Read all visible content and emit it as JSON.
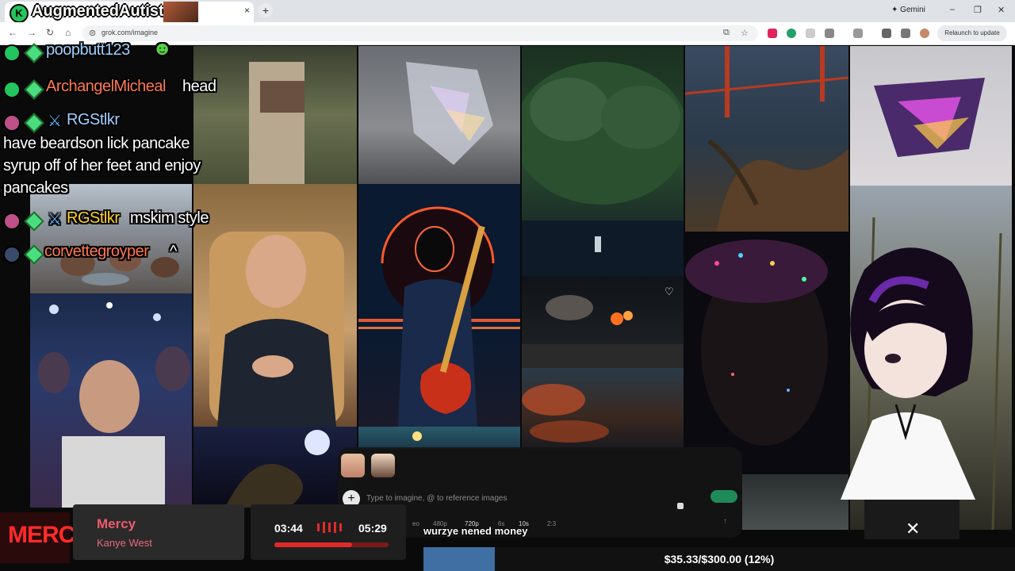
{
  "browser": {
    "tab_title": "AugmentedAutist",
    "tab_favicon_letter": "K",
    "url": "grok.com/imagine",
    "gemini_label": "Gemini",
    "relaunch_label": "Relaunch to update",
    "win_min": "–",
    "win_max": "❐",
    "win_close": "✕",
    "tab_close": "×",
    "new_tab": "+"
  },
  "chat": {
    "messages": [
      {
        "user": "poopbutt123",
        "text": "",
        "user_color": "#9ed0ff"
      },
      {
        "user": "ArchangelMicheal",
        "text": "head",
        "user_color": "#ff7a50"
      },
      {
        "user": "RGStlkr",
        "text": "",
        "user_color": "#9ed0ff"
      },
      {
        "user": "",
        "text": "have beardson lick pancake",
        "user_color": "#ffffff"
      },
      {
        "user": "",
        "text": "syrup off of her feet and enjoy",
        "user_color": "#ffffff"
      },
      {
        "user": "",
        "text": "pancakes",
        "user_color": "#ffffff"
      },
      {
        "user": "RGStlkr",
        "text": "mskim style",
        "user_color": "#ffd028"
      },
      {
        "user": "corvettegroyper",
        "text": "^",
        "user_color": "#ff7a50"
      }
    ]
  },
  "generator": {
    "placeholder": "Type to imagine, @ to reference images",
    "plus": "+",
    "options": [
      {
        "label": "eo",
        "selected": false
      },
      {
        "label": "480p",
        "selected": false
      },
      {
        "label": "720p",
        "selected": true
      },
      {
        "label": "6s",
        "selected": false
      },
      {
        "label": "10s",
        "selected": true
      },
      {
        "label": "2:3",
        "selected": false
      }
    ],
    "submit_icon": "arrow-up-icon"
  },
  "now_playing": {
    "logo_text": "MERCY",
    "song": "Mercy",
    "artist": "Kanye West",
    "elapsed": "03:44",
    "duration": "05:29",
    "progress": 0.68
  },
  "caption": "wurzye nened money",
  "goal": {
    "text": "$35.33/$300.00 (12%)",
    "progress": 0.12
  },
  "colors": {
    "accent_green": "#22c55e",
    "goal_blue": "#3f6fa3",
    "np_red": "#e02a2a"
  }
}
